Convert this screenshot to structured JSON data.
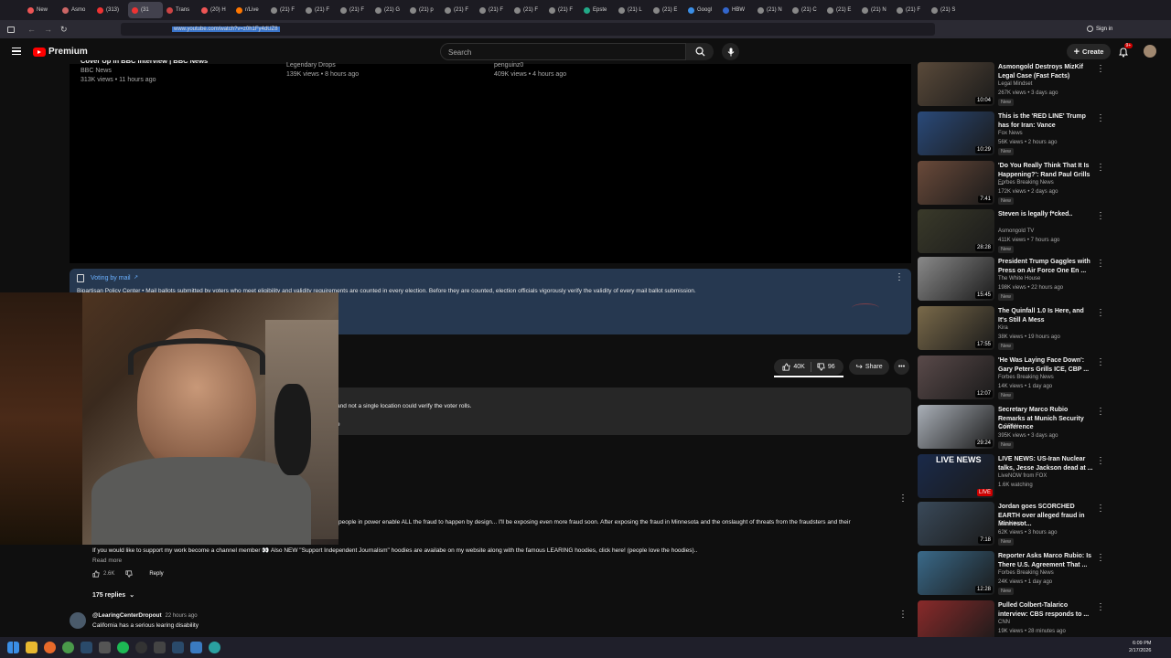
{
  "browser": {
    "tabs": [
      "New",
      "Asmo",
      "(313)",
      "(31",
      "Trans",
      "(20) H",
      "r/Live",
      "(21) F",
      "(21) F",
      "(21) F",
      "(21) G",
      "(21) p",
      "(21) F",
      "(21) F",
      "(21) F",
      "(21) F",
      "Epste",
      "(21) L",
      "(21) E",
      "Googl",
      "HBW",
      "(21) N",
      "(21) C",
      "(21) E",
      "(21) N",
      "(21) F",
      "(21) S"
    ],
    "url": "www.youtube.com/watch?v=z0h1Fy4dUZ8",
    "sign_in": "Sign in"
  },
  "youtube": {
    "logo": "Premium",
    "search_placeholder": "Search",
    "create_label": "Create",
    "notif_count": "9+"
  },
  "endcards": [
    {
      "title": "Cover Up in BBC Interview | BBC News",
      "channel": "BBC News",
      "meta": "313K views • 11 hours ago"
    },
    {
      "channel": "Legendary Drops",
      "meta": "139K views • 8 hours ago"
    },
    {
      "channel": "penguinz0",
      "meta": "409K views • 4 hours ago"
    }
  ],
  "info_panel": {
    "title": "Voting by mail",
    "text": "Bipartisan Policy Center • Mail ballots submitted by voters who meet eligibility and validity requirements are counted in every election. Before they are counted, election officials vigorously verify the validity of every mail ballot submission."
  },
  "actions": {
    "likes": "40K",
    "dislikes": "96",
    "share": "Share"
  },
  "description": {
    "text": "and not a single location could verify the voter rolls.",
    "more": "e"
  },
  "pinned_comment": {
    "text_cut": "people in power enable ALL the fraud to happen by design... I'll be exposing even more fraud soon. After exposing the fraud in Minnesota and the onslaught of threats from the fraudsters and their",
    "text2": "If you would like to support my work become a channel member 👀 Also NEW \"Support Independent Journalism\" hoodies are availabe on my website along with the famous LEARING hoodies, click here! (people love the hoodies)..",
    "read_more": "Read more",
    "likes": "2.6K",
    "reply": "Reply",
    "replies": "175 replies"
  },
  "comment2": {
    "author": "@LearingCenterDropout",
    "time": "22 hours ago",
    "text": "California has a serious learing disability"
  },
  "recommendations": [
    {
      "title": "Asmongold Destroys MizKif Legal Case (Fast Facts)",
      "channel": "Legal Mindset",
      "views": "267K views • 3 days ago",
      "dur": "10:04",
      "badge": "New",
      "color": "#5a4a3a"
    },
    {
      "title": "This is the 'RED LINE' Trump has for Iran: Vance",
      "channel": "Fox News",
      "views": "56K views • 2 hours ago",
      "dur": "10:29",
      "badge": "New",
      "color": "#2a4a7a"
    },
    {
      "title": "'Do You Really Think That It Is Happening?': Rand Paul Grills ...",
      "channel": "Forbes Breaking News",
      "views": "172K views • 2 days ago",
      "dur": "7:41",
      "badge": "New",
      "color": "#6a4a3a"
    },
    {
      "title": "Steven is legally f*cked..",
      "channel": "Asmongold TV",
      "views": "411K views • 7 hours ago",
      "dur": "28:28",
      "badge": "New",
      "color": "#3a3a2a"
    },
    {
      "title": "President Trump Gaggles with Press on Air Force One En ...",
      "channel": "The White House",
      "views": "198K views • 22 hours ago",
      "dur": "15:45",
      "badge": "New",
      "color": "#8a8a8a"
    },
    {
      "title": "The Quinfall 1.0 Is Here, and It's Still A Mess",
      "channel": "Kira",
      "views": "38K views • 19 hours ago",
      "dur": "17:55",
      "badge": "New",
      "color": "#7a6a4a"
    },
    {
      "title": "'He Was Laying Face Down': Gary Peters Grills ICE, CBP ...",
      "channel": "Forbes Breaking News",
      "views": "14K views • 1 day ago",
      "dur": "12:07",
      "badge": "New",
      "color": "#5a4a4a"
    },
    {
      "title": "Secretary Marco Rubio Remarks at Munich Security Conference",
      "channel": "C-SPAN",
      "views": "395K views • 3 days ago",
      "dur": "29:24",
      "badge": "New",
      "color": "#aab0b8"
    },
    {
      "title": "LIVE NEWS: US-Iran Nuclear talks, Jesse Jackson dead at ...",
      "channel": "LiveNOW from FOX",
      "views": "1.6K watching",
      "dur": "LIVE",
      "badge": "",
      "thumb_text": "LIVE NEWS",
      "color": "#1a2a4a"
    },
    {
      "title": "Jordan goes SCORCHED EARTH over alleged fraud in Minnesot...",
      "channel": "Fox News",
      "views": "62K views • 3 hours ago",
      "dur": "7:18",
      "badge": "New",
      "color": "#3a4a5a"
    },
    {
      "title": "Reporter Asks Marco Rubio: Is There U.S. Agreement That ...",
      "channel": "Forbes Breaking News",
      "views": "24K views • 1 day ago",
      "dur": "12:28",
      "badge": "New",
      "color": "#3a6a8a"
    },
    {
      "title": "Pulled Colbert-Talarico interview: CBS responds to ...",
      "channel": "CNN",
      "views": "19K views • 28 minutes ago",
      "dur": "",
      "badge": "",
      "color": "#8a2a2a"
    }
  ],
  "taskbar": {
    "time": "6:09 PM",
    "date": "2/17/2026"
  }
}
